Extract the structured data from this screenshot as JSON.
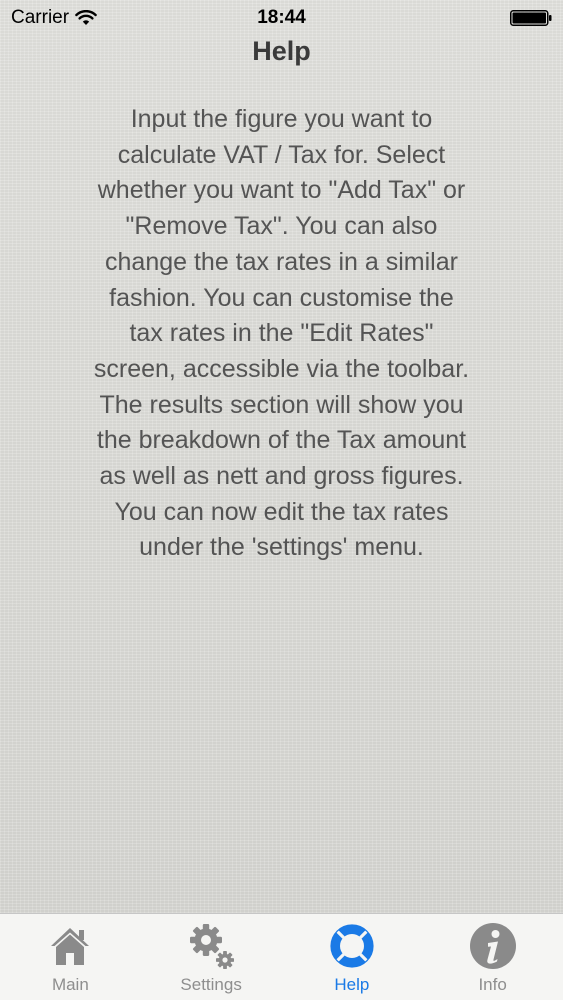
{
  "status_bar": {
    "carrier": "Carrier",
    "time": "18:44"
  },
  "header": {
    "title": "Help"
  },
  "help": {
    "text": "Input the figure you want to\ncalculate VAT / Tax for.  Select\nwhether you want to \"Add Tax\" or\n\"Remove Tax\".  You can also\nchange the tax rates in a similar\nfashion.  You can customise the\ntax rates in the \"Edit Rates\"\nscreen, accessible via the toolbar.\nThe results section will show you\nthe breakdown of the Tax amount\nas well as nett and gross figures.\nYou can now edit the tax rates\nunder the 'settings' menu."
  },
  "tab_bar": {
    "active_color": "#1a7ae6",
    "inactive_color": "#8e8e8e",
    "items": [
      {
        "label": "Main",
        "icon": "house-icon",
        "active": false
      },
      {
        "label": "Settings",
        "icon": "gears-icon",
        "active": false
      },
      {
        "label": "Help",
        "icon": "lifebuoy-icon",
        "active": true
      },
      {
        "label": "Info",
        "icon": "info-icon",
        "active": false
      }
    ]
  }
}
